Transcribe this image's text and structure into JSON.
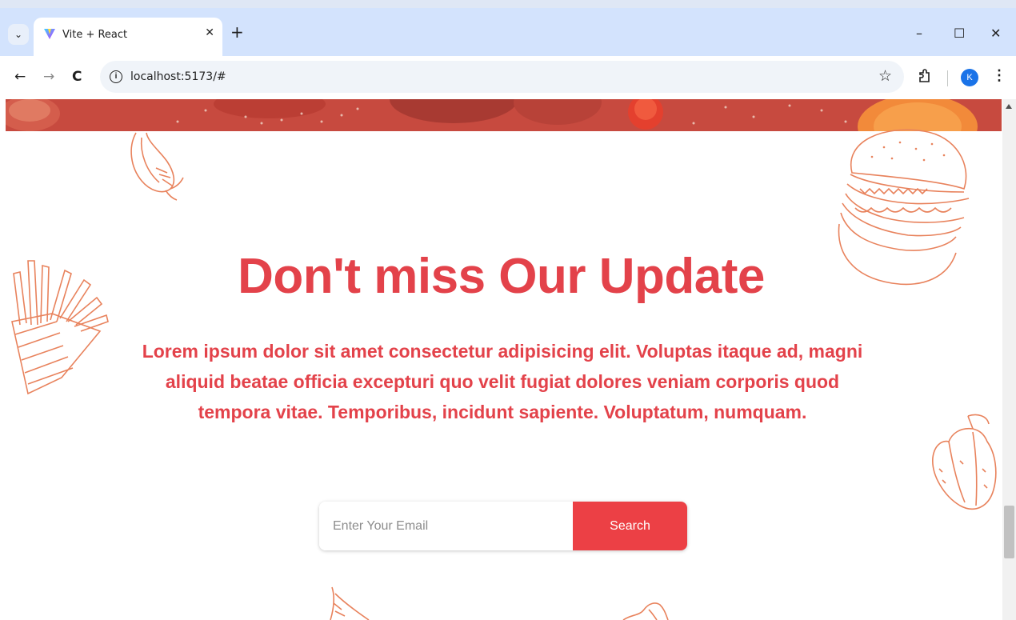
{
  "browser": {
    "tab_title": "Vite + React",
    "tab_close": "✕",
    "new_tab": "+",
    "tab_list": "⌄",
    "url": "localhost:5173/#",
    "profile_initial": "K",
    "back": "←",
    "forward": "→",
    "reload": "C",
    "minimize": "–",
    "maximize": "☐",
    "close": "✕",
    "bookmark": "☆",
    "menu": "⋮"
  },
  "page": {
    "headline": "Don't miss Our Update",
    "subtext": "Lorem ipsum dolor sit amet consectetur adipisicing elit. Voluptas itaque ad, magni aliquid beatae officia excepturi quo velit fugiat dolores veniam corporis quod tempora vitae. Temporibus, incidunt sapiente. Voluptatum, numquam.",
    "email_placeholder": "Enter Your Email",
    "search_label": "Search"
  },
  "colors": {
    "accent": "#e3424a",
    "button": "#ec4045",
    "doodle": "#e8825c",
    "hero_strip": "#c9473b"
  }
}
